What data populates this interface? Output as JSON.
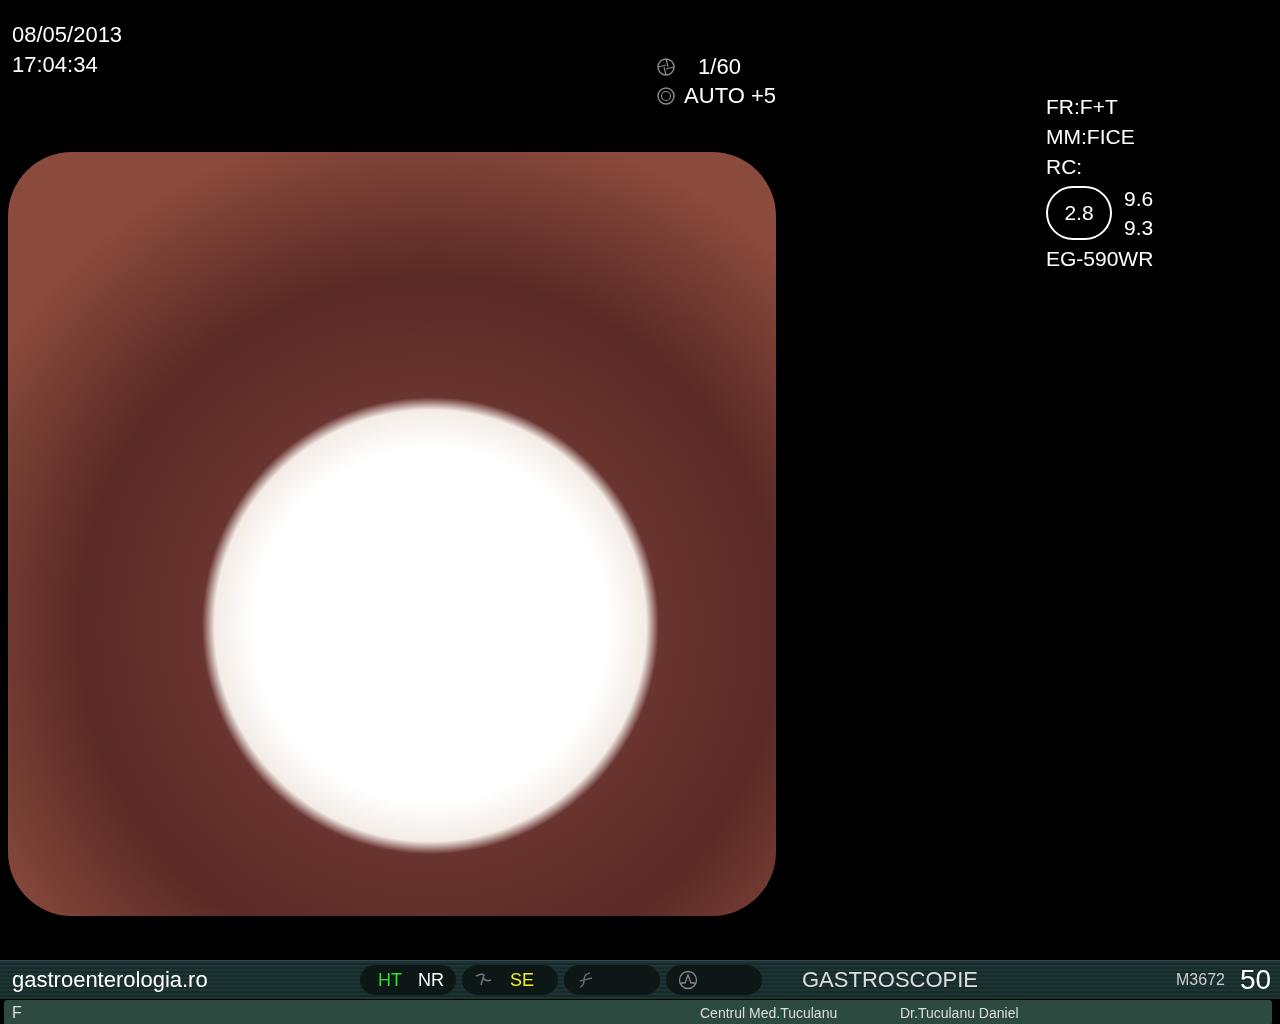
{
  "datetime": {
    "date": "08/05/2013",
    "time": "17:04:34"
  },
  "exposure": {
    "shutter": "1/60",
    "iris": "AUTO +5"
  },
  "settings": {
    "lines": [
      "FR:F+T",
      "MM:FICE",
      "RC:"
    ],
    "ratio": "2.8",
    "values": [
      "9.6",
      "9.3"
    ],
    "scope": "EG-590WR"
  },
  "status_bar": {
    "site": "gastroenterologia.ro",
    "indicators": [
      {
        "items": [
          {
            "kind": "text",
            "text": "HT",
            "color": "#33dd33"
          },
          {
            "kind": "text",
            "text": "NR",
            "color": "#ffffff"
          }
        ]
      },
      {
        "items": [
          {
            "kind": "curve-icon"
          },
          {
            "kind": "text",
            "text": "SE",
            "color": "#eeee22"
          }
        ]
      },
      {
        "items": [
          {
            "kind": "slash-icon"
          }
        ]
      },
      {
        "items": [
          {
            "kind": "wave-icon"
          }
        ]
      }
    ],
    "procedure": "GASTROSCOPIE",
    "code": "M3672",
    "number": "50"
  },
  "info_bar": {
    "label": "F",
    "center": "Centrul Med.Tuculanu",
    "doctor": "Dr.Tuculanu Daniel"
  }
}
